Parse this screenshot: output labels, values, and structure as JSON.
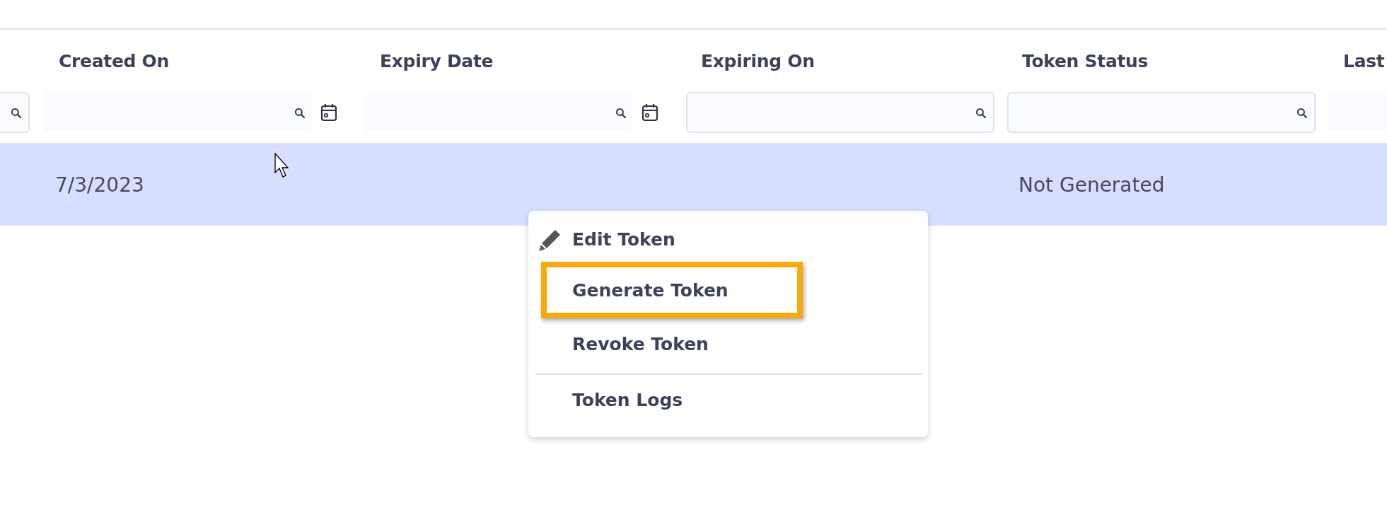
{
  "table": {
    "columns": [
      {
        "kind": "text",
        "calendar_button": false
      },
      {
        "header": "Created On",
        "kind": "date",
        "calendar_button": true
      },
      {
        "header": "Expiry Date",
        "kind": "date",
        "calendar_button": true
      },
      {
        "header": "Expiring On",
        "kind": "text",
        "calendar_button": false
      },
      {
        "header": "Token Status",
        "kind": "text",
        "calendar_button": false
      },
      {
        "header": "Last",
        "kind": "partial"
      }
    ],
    "rows": [
      {
        "selected": true,
        "cells": [
          "",
          "7/3/2023",
          "",
          "",
          "Not Generated",
          ""
        ]
      }
    ]
  },
  "context_menu": {
    "items": [
      {
        "label": "Edit Token",
        "kind": "edit",
        "highlighted": false,
        "separator_before": false
      },
      {
        "label": "Generate Token",
        "kind": "plain",
        "highlighted": true,
        "separator_before": false
      },
      {
        "label": "Revoke Token",
        "kind": "plain",
        "highlighted": false,
        "separator_before": false
      },
      {
        "label": "Token Logs",
        "kind": "plain",
        "highlighted": false,
        "separator_before": true
      }
    ]
  }
}
